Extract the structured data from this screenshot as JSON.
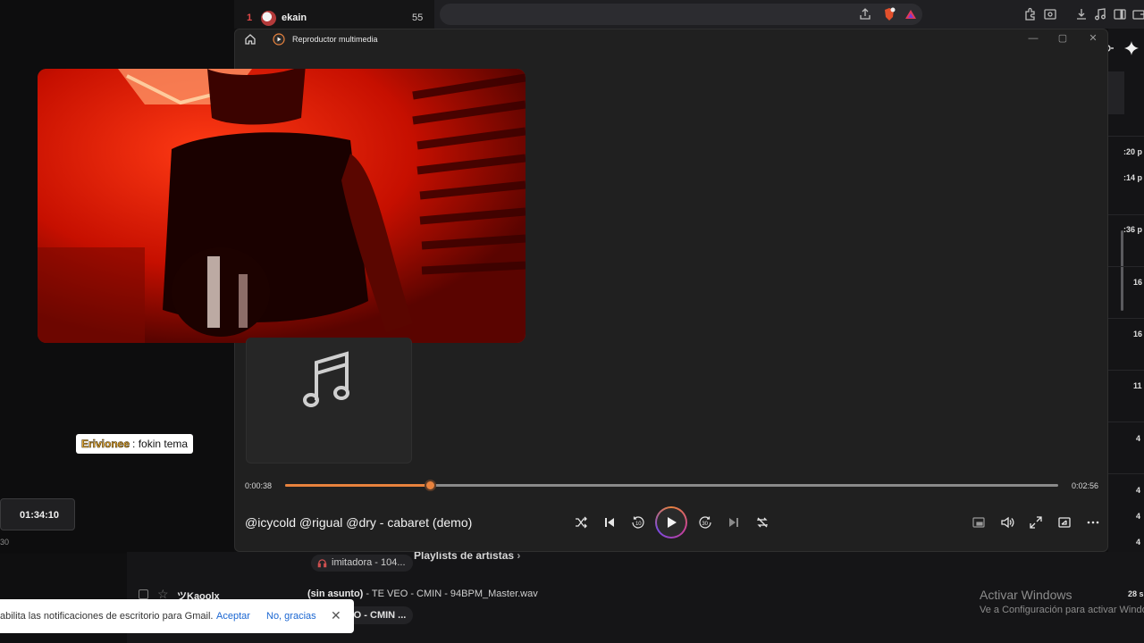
{
  "leaderboard": {
    "rank": "1",
    "name": "ekain",
    "score": "55"
  },
  "player": {
    "app_title": "Reproductor multimedia",
    "song_title": "@icycold @rigual @dry - cabaret (demo)",
    "time_current": "0:00:38",
    "time_total": "0:02:56",
    "progress_fraction": 0.187,
    "accent_color": "#e8823d",
    "controls": [
      "shuffle-icon",
      "previous-icon",
      "rewind-10-icon",
      "play-icon",
      "forward-30-icon",
      "next-icon",
      "repeat-icon"
    ],
    "right_controls": [
      "miniplayer-icon",
      "volume-icon",
      "fullscreen-icon",
      "cast-icon",
      "more-icon"
    ],
    "rewind_label": "10",
    "forward_label": "30"
  },
  "chat": {
    "user": "Erivionee",
    "message": ": fokin tema"
  },
  "stream": {
    "clock": "01:34:10",
    "small": "30"
  },
  "gmail": {
    "times": [
      ":20 p",
      ":14 p",
      ":36 p",
      "16",
      "16",
      "11",
      "4",
      "4",
      "4",
      "4"
    ],
    "chip_label": "imitadora - 104...",
    "section_label": "Playlists de artistas",
    "row_sender": "ツKaoolx",
    "row_subject_bold": "(sin asunto)",
    "row_subject_rest": " - TE VEO - CMIN - 94BPM_Master.wav",
    "row_date": "28 s",
    "attachment_label": "VEO - CMIN ..."
  },
  "windows": {
    "activate_title": "Activar Windows",
    "activate_sub": "Ve a Configuración para activar Windows"
  },
  "notification": {
    "text": "abilita las notificaciones de escritorio para Gmail.",
    "accept": "Aceptar",
    "decline": "No, gracias",
    "close": "✕"
  }
}
